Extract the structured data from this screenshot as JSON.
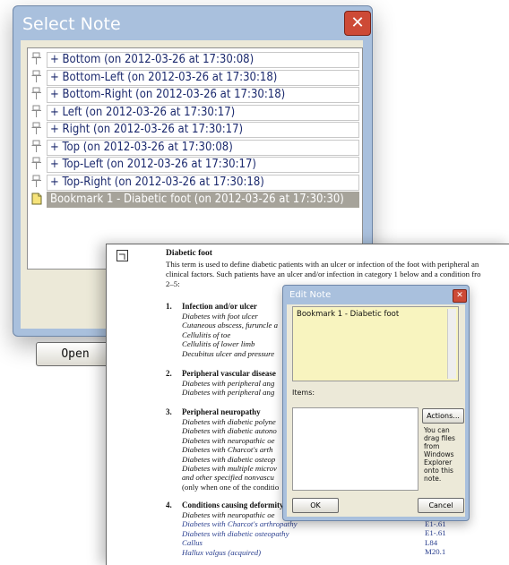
{
  "select_note": {
    "title": "Select Note",
    "close_glyph": "✕",
    "items": [
      {
        "label": "+ Bottom (on 2012-03-26 at 17:30:08)",
        "icon": "pin-icon"
      },
      {
        "label": "+ Bottom-Left (on 2012-03-26 at 17:30:18)",
        "icon": "pin-icon"
      },
      {
        "label": "+ Bottom-Right (on 2012-03-26 at 17:30:18)",
        "icon": "pin-icon"
      },
      {
        "label": "+ Left (on 2012-03-26 at 17:30:17)",
        "icon": "pin-icon"
      },
      {
        "label": "+ Right (on 2012-03-26 at 17:30:17)",
        "icon": "pin-icon"
      },
      {
        "label": "+ Top (on 2012-03-26 at 17:30:08)",
        "icon": "pin-icon"
      },
      {
        "label": "+ Top-Left (on 2012-03-26 at 17:30:17)",
        "icon": "pin-icon"
      },
      {
        "label": "+ Top-Right (on 2012-03-26 at 17:30:18)",
        "icon": "pin-icon"
      },
      {
        "label": "Bookmark 1 - Diabetic foot (on 2012-03-26 at 17:30:30)",
        "icon": "bookmark-icon",
        "selected": true
      }
    ],
    "open_label": "Open"
  },
  "document": {
    "heading": "Diabetic foot",
    "intro_lines": [
      "This term is used to define diabetic patients with an ulcer or infection of the foot with peripheral an",
      "clinical factors. Such patients have an ulcer and/or infection in category 1 below and a condition fro",
      "2–5:"
    ],
    "sections": [
      {
        "num": "1.",
        "heading": "Infection and/or ulcer",
        "lines": [
          "Diabetes with foot ulcer",
          "Cutaneous abscess, furuncle a",
          "Cellulitis of toe",
          "Cellulitis of lower limb",
          "Decubitus ulcer and pressure"
        ]
      },
      {
        "num": "2.",
        "heading": "Peripheral vascular disease",
        "lines": [
          "Diabetes with peripheral ang",
          "Diabetes with peripheral ang"
        ]
      },
      {
        "num": "3.",
        "heading": "Peripheral neuropathy",
        "lines": [
          "Diabetes with diabetic polyne",
          "Diabetes with diabetic autono",
          "Diabetes with neuropathic oe",
          "Diabetes with Charcot's arth",
          "Diabetes with diabetic osteop",
          "Diabetes with multiple microv",
          "and other specified nonvascu",
          "(only when one of the conditio"
        ]
      },
      {
        "num": "4.",
        "heading": "Conditions causing deformity",
        "lines": [
          "Diabetes with neuropathic oe",
          "Diabetes with Charcot's arthropathy",
          "Diabetes with diabetic osteopathy",
          "Callus",
          "Hallux valgus (acquired)"
        ]
      }
    ],
    "codes": [
      "E1-.61",
      "E1-.61",
      "L84",
      "M20.1"
    ]
  },
  "edit_note": {
    "title": "Edit Note",
    "close_glyph": "✕",
    "text": "Bookmark 1 - Diabetic foot",
    "items_label": "Items:",
    "actions_label": "Actions...",
    "drag_hint": "You can drag files from Windows Explorer onto this note.",
    "ok_label": "OK",
    "cancel_label": "Cancel"
  }
}
